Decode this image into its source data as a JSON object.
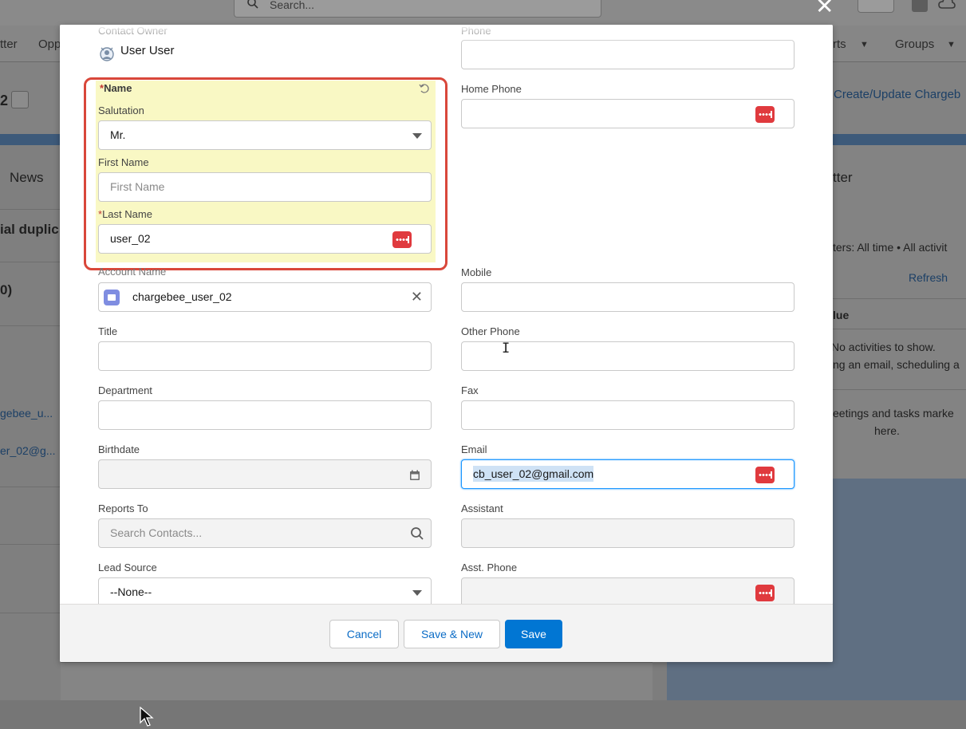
{
  "background": {
    "search_placeholder": "Search...",
    "nav_left": [
      "tter",
      "Opp"
    ],
    "nav_right": [
      "rts",
      "Groups"
    ],
    "record_fragment": "2",
    "create_update_link": "Create/Update Chargeb",
    "tab_news": "News",
    "tab_chatter": "tter",
    "duplicate_text": "ial duplic",
    "paren_text": "0)",
    "left_link_1": "gebee_u...",
    "left_link_2": "er_02@g...",
    "filters_text": "ters: All time • All activit",
    "refresh_link": "Refresh",
    "due_header": "lue",
    "no_activities": "No activities to show.",
    "get_started": "ng an email, scheduling a",
    "meetings_text": "eetings and tasks marke",
    "here_text": "here."
  },
  "modal": {
    "contact_owner": {
      "label": "Contact Owner",
      "value": "User User"
    },
    "name_section": {
      "label": "Name",
      "salutation": {
        "label": "Salutation",
        "value": "Mr."
      },
      "first_name": {
        "label": "First Name",
        "placeholder": "First Name",
        "value": ""
      },
      "last_name": {
        "label": "Last Name",
        "value": "user_02"
      }
    },
    "account_name": {
      "label": "Account Name",
      "value": "chargebee_user_02"
    },
    "title": {
      "label": "Title",
      "value": ""
    },
    "department": {
      "label": "Department",
      "value": ""
    },
    "birthdate": {
      "label": "Birthdate",
      "value": ""
    },
    "reports_to": {
      "label": "Reports To",
      "placeholder": "Search Contacts..."
    },
    "lead_source": {
      "label": "Lead Source",
      "value": "--None--"
    },
    "phone": {
      "label": "Phone",
      "value": ""
    },
    "home_phone": {
      "label": "Home Phone",
      "value": ""
    },
    "mobile": {
      "label": "Mobile",
      "value": ""
    },
    "other_phone": {
      "label": "Other Phone",
      "value": ""
    },
    "fax": {
      "label": "Fax",
      "value": ""
    },
    "email": {
      "label": "Email",
      "value": "cb_user_02@gmail.com"
    },
    "assistant": {
      "label": "Assistant",
      "value": ""
    },
    "asst_phone": {
      "label": "Asst. Phone",
      "value": ""
    },
    "required_marker": "*"
  },
  "footer": {
    "cancel_label": "Cancel",
    "save_new_label": "Save & New",
    "save_label": "Save"
  },
  "colors": {
    "brand_blue": "#0176d3",
    "highlight_box": "#d9473a",
    "highlight_fill": "#f9f8c4",
    "lastpass_red": "#e03a3e"
  }
}
